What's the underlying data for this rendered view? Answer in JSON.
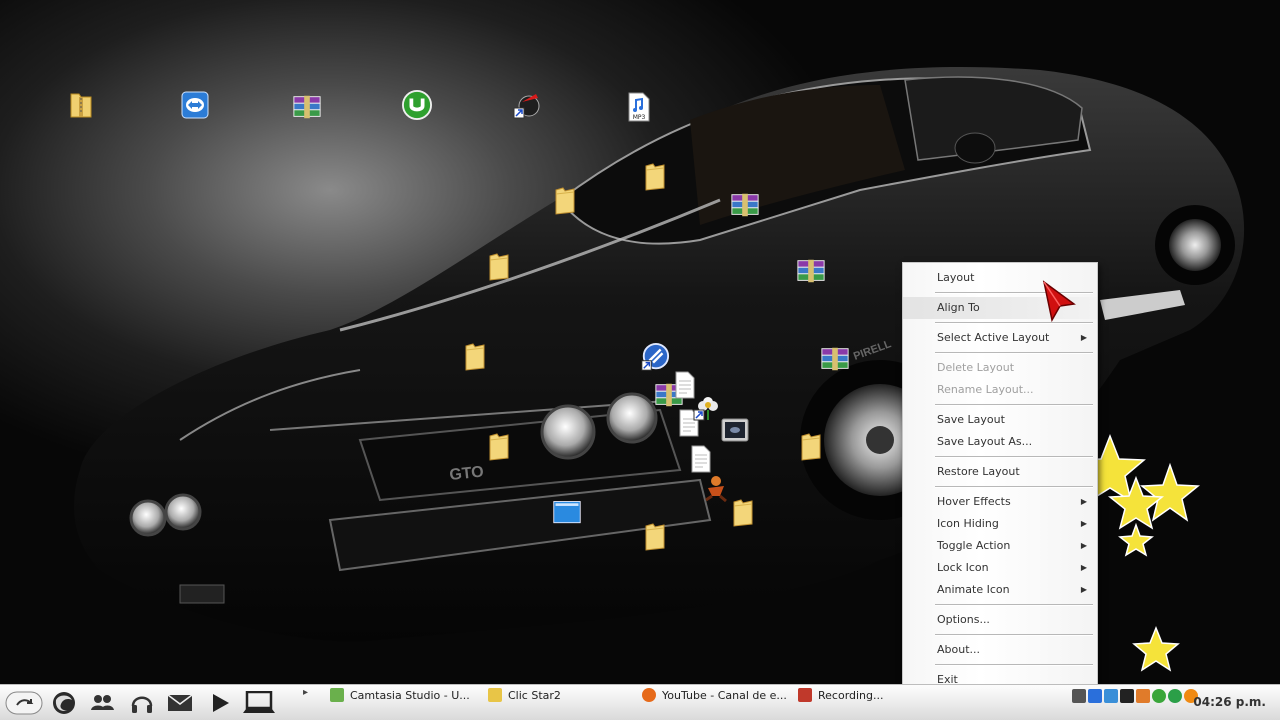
{
  "desktop": {
    "icons": [
      {
        "name": "folder-zip-icon"
      },
      {
        "name": "teamviewer-icon"
      },
      {
        "name": "winrar-icon"
      },
      {
        "name": "utorrent-icon"
      },
      {
        "name": "shortcut-app-icon"
      },
      {
        "name": "mp3-file-icon",
        "label": "MP3"
      },
      {
        "name": "folder-icon"
      },
      {
        "name": "folder-icon"
      },
      {
        "name": "folder-icon"
      },
      {
        "name": "folder-icon"
      },
      {
        "name": "folder-icon"
      },
      {
        "name": "folder-icon"
      },
      {
        "name": "folder-icon"
      },
      {
        "name": "folder-icon"
      },
      {
        "name": "winrar-icon"
      },
      {
        "name": "winrar-icon"
      },
      {
        "name": "winrar-icon"
      },
      {
        "name": "winrar-icon"
      },
      {
        "name": "shortcut-globe-icon"
      },
      {
        "name": "document-icon"
      },
      {
        "name": "document-icon"
      },
      {
        "name": "document-icon"
      },
      {
        "name": "shortcut-flower-icon"
      },
      {
        "name": "monitor-icon"
      },
      {
        "name": "character-icon"
      },
      {
        "name": "blue-window-icon"
      }
    ],
    "wallpaper": {
      "badge_text": "GTO",
      "tire_text": "PIRELL"
    }
  },
  "context_menu": {
    "items": [
      {
        "label": "Layout",
        "disabled": false,
        "submenu": false
      },
      {
        "label": "Align To",
        "disabled": false,
        "submenu": false,
        "highlight": true
      },
      {
        "label": "Select Active Layout",
        "disabled": false,
        "submenu": true
      },
      {
        "label": "Delete Layout",
        "disabled": true,
        "submenu": false
      },
      {
        "label": "Rename Layout...",
        "disabled": true,
        "submenu": false
      },
      {
        "label": "Save Layout",
        "disabled": false,
        "submenu": false
      },
      {
        "label": "Save Layout As...",
        "disabled": false,
        "submenu": false
      },
      {
        "label": "Restore Layout",
        "disabled": false,
        "submenu": false
      },
      {
        "label": "Hover Effects",
        "disabled": false,
        "submenu": true
      },
      {
        "label": "Icon Hiding",
        "disabled": false,
        "submenu": true
      },
      {
        "label": "Toggle Action",
        "disabled": false,
        "submenu": true
      },
      {
        "label": "Lock Icon",
        "disabled": false,
        "submenu": true
      },
      {
        "label": "Animate Icon",
        "disabled": false,
        "submenu": true
      },
      {
        "label": "Options...",
        "disabled": false,
        "submenu": false
      },
      {
        "label": "About...",
        "disabled": false,
        "submenu": false
      },
      {
        "label": "Exit",
        "disabled": false,
        "submenu": false
      }
    ],
    "submenu_arrow": "▶"
  },
  "taskbar": {
    "quick_launch": [
      {
        "name": "start-button"
      },
      {
        "name": "firefox-icon"
      },
      {
        "name": "contacts-icon"
      },
      {
        "name": "headphones-icon"
      },
      {
        "name": "mail-icon"
      },
      {
        "name": "play-icon"
      },
      {
        "name": "laptop-icon"
      }
    ],
    "expand_arrow": "▸",
    "tasks": [
      {
        "label": "Camtasia Studio - U...",
        "icon": "camtasia-icon",
        "color": "#6ab04c"
      },
      {
        "label": "Clic Star2",
        "icon": "clicstar-icon",
        "color": "#e8c547"
      },
      {
        "label": "YouTube - Canal de e...",
        "icon": "firefox-icon",
        "color": "#e66a1a"
      },
      {
        "label": "Recording...",
        "icon": "recording-icon",
        "color": "#c0392b"
      }
    ],
    "tray_icons": [
      {
        "name": "tray-x-icon",
        "color": "#555555"
      },
      {
        "name": "tray-bluetooth-icon",
        "color": "#2a6fdb"
      },
      {
        "name": "tray-network-icon",
        "color": "#3a8fd8"
      },
      {
        "name": "tray-signal-icon",
        "color": "#222222"
      },
      {
        "name": "tray-app-icon",
        "color": "#e07b2a"
      },
      {
        "name": "tray-green-icon",
        "color": "#3aa63a"
      },
      {
        "name": "tray-chrome-icon",
        "color": "#2b9f48"
      },
      {
        "name": "tray-avast-icon",
        "color": "#f08a12"
      }
    ],
    "clock": "04:26 p.m."
  },
  "colors": {
    "menu_bg": "#ffffff",
    "menu_disabled": "#a0a0a0",
    "star": "#f5e33a",
    "cursor": "#d01010"
  }
}
